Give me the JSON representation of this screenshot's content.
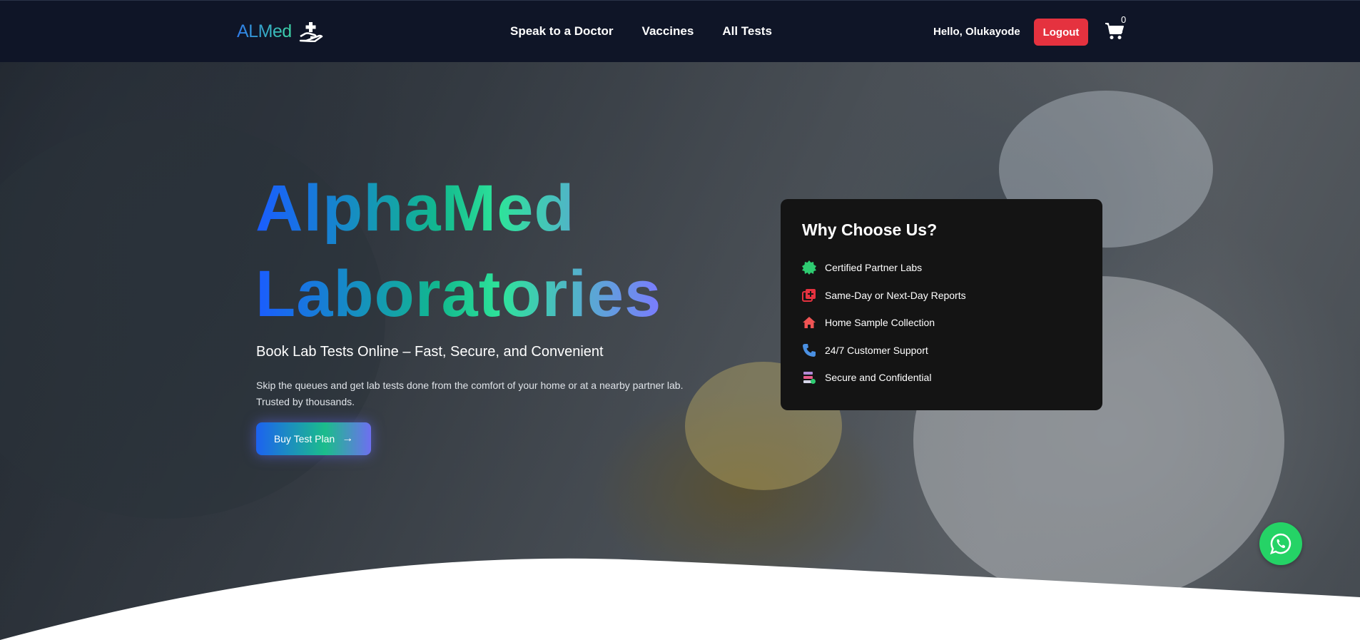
{
  "nav": {
    "logo_text": "ALMed",
    "links": [
      "Speak to a Doctor",
      "Vaccines",
      "All Tests"
    ],
    "greeting": "Hello, Olukayode",
    "logout_label": "Logout",
    "cart_count": "0"
  },
  "hero": {
    "title_line1": "AlphaMed",
    "title_line2": "Laboratories",
    "subtitle": "Book Lab Tests Online – Fast, Secure, and Convenient",
    "description": "Skip the queues and get lab tests done from the comfort of your home or at a nearby partner lab. Trusted by thousands.",
    "cta_label": "Buy Test Plan"
  },
  "why_card": {
    "title": "Why Choose Us?",
    "features": [
      {
        "label": "Certified Partner Labs",
        "icon": "certified-badge-icon",
        "color": "#2ecc71"
      },
      {
        "label": "Same-Day or Next-Day Reports",
        "icon": "reports-icon",
        "color": "#e5323f"
      },
      {
        "label": "Home Sample Collection",
        "icon": "home-icon",
        "color": "#f05454"
      },
      {
        "label": "24/7 Customer Support",
        "icon": "phone-icon",
        "color": "#4a90e2"
      },
      {
        "label": "Secure and Confidential",
        "icon": "secure-database-icon",
        "color": "#b28bd6"
      }
    ]
  },
  "colors": {
    "navbar_bg": "#0f1527",
    "logout_bg": "#e5323f",
    "whatsapp_bg": "#25d366"
  }
}
